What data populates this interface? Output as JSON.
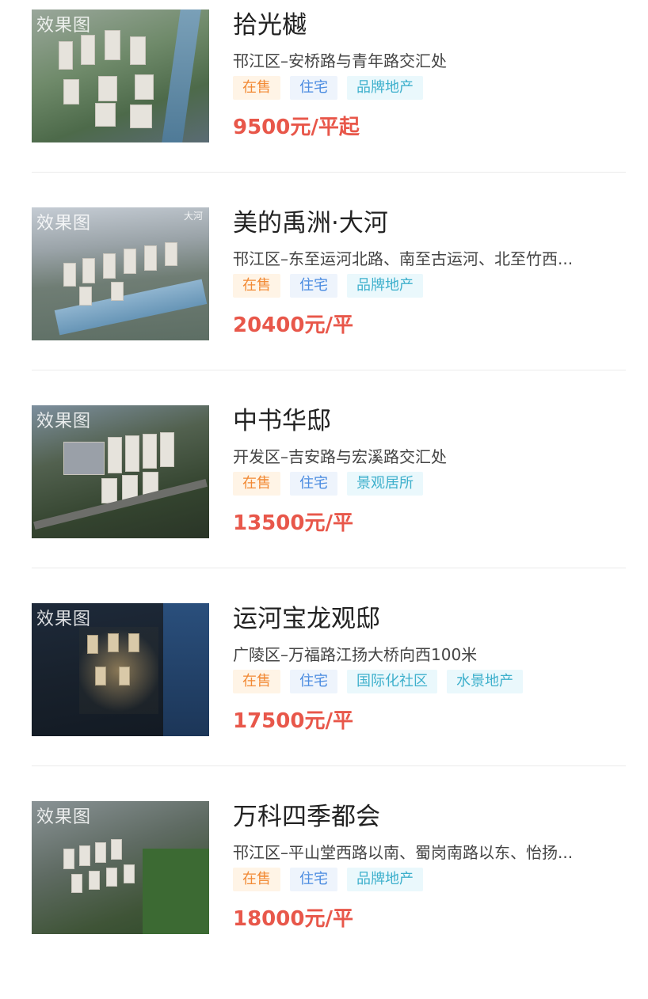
{
  "listings": [
    {
      "name": "拾光樾",
      "address": "邗江区–安桥路与青年路交汇处",
      "image_tag": "效果图",
      "image_logo": "",
      "tags": [
        {
          "label": "在售",
          "kind": "sale"
        },
        {
          "label": "住宅",
          "kind": "type"
        },
        {
          "label": "品牌地产",
          "kind": "feat"
        }
      ],
      "price": "9500元/平起"
    },
    {
      "name": "美的禹洲·大河",
      "address": "邗江区–东至运河北路、南至古运河、北至竹西...",
      "image_tag": "效果图",
      "image_logo": "大河",
      "tags": [
        {
          "label": "在售",
          "kind": "sale"
        },
        {
          "label": "住宅",
          "kind": "type"
        },
        {
          "label": "品牌地产",
          "kind": "feat"
        }
      ],
      "price": "20400元/平"
    },
    {
      "name": "中书华邸",
      "address": "开发区–吉安路与宏溪路交汇处",
      "image_tag": "效果图",
      "image_logo": "",
      "tags": [
        {
          "label": "在售",
          "kind": "sale"
        },
        {
          "label": "住宅",
          "kind": "type"
        },
        {
          "label": "景观居所",
          "kind": "feat"
        }
      ],
      "price": "13500元/平"
    },
    {
      "name": "运河宝龙观邸",
      "address": "广陵区–万福路江扬大桥向西100米",
      "image_tag": "效果图",
      "image_logo": "",
      "tags": [
        {
          "label": "在售",
          "kind": "sale"
        },
        {
          "label": "住宅",
          "kind": "type"
        },
        {
          "label": "国际化社区",
          "kind": "feat"
        },
        {
          "label": "水景地产",
          "kind": "feat"
        }
      ],
      "price": "17500元/平"
    },
    {
      "name": "万科四季都会",
      "address": "邗江区–平山堂西路以南、蜀岗南路以东、怡扬...",
      "image_tag": "效果图",
      "image_logo": "",
      "tags": [
        {
          "label": "在售",
          "kind": "sale"
        },
        {
          "label": "住宅",
          "kind": "type"
        },
        {
          "label": "品牌地产",
          "kind": "feat"
        }
      ],
      "price": "18000元/平"
    }
  ],
  "colors": {
    "price": "#e8574a",
    "sale_chip_bg": "#fff4e6",
    "sale_chip_text": "#f28a35",
    "type_chip_bg": "#eef4fc",
    "type_chip_text": "#4a8be0",
    "feat_chip_bg": "#eaf8fc",
    "feat_chip_text": "#3eb0cc"
  }
}
